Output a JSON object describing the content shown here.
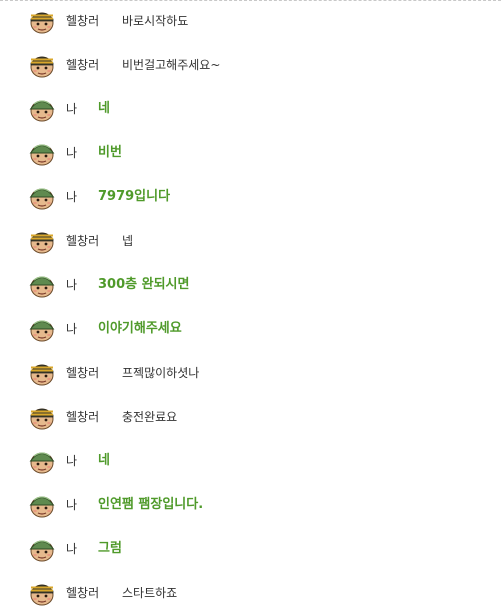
{
  "colors": {
    "my_text": "#4f9a2a",
    "other_text": "#333333"
  },
  "messages": [
    {
      "sender": "헬창러",
      "text": "바로시작하됴",
      "me": false,
      "avatar": "soldier-striped-cap-icon"
    },
    {
      "sender": "헬창러",
      "text": "비번걸고해주세요~",
      "me": false,
      "avatar": "soldier-striped-cap-icon"
    },
    {
      "sender": "나",
      "text": "네",
      "me": true,
      "avatar": "soldier-green-helmet-icon"
    },
    {
      "sender": "나",
      "text": "비번",
      "me": true,
      "avatar": "soldier-green-helmet-icon"
    },
    {
      "sender": "나",
      "text": "7979입니다",
      "me": true,
      "avatar": "soldier-green-helmet-icon"
    },
    {
      "sender": "헬창러",
      "text": "넵",
      "me": false,
      "avatar": "soldier-striped-cap-icon"
    },
    {
      "sender": "나",
      "text": "300층 완되시면",
      "me": true,
      "avatar": "soldier-green-helmet-icon"
    },
    {
      "sender": "나",
      "text": "이야기해주세요",
      "me": true,
      "avatar": "soldier-green-helmet-icon"
    },
    {
      "sender": "헬창러",
      "text": "프젝많이하셧나",
      "me": false,
      "avatar": "soldier-striped-cap-icon"
    },
    {
      "sender": "헬창러",
      "text": "충전완료요",
      "me": false,
      "avatar": "soldier-striped-cap-icon"
    },
    {
      "sender": "나",
      "text": "네",
      "me": true,
      "avatar": "soldier-green-helmet-icon"
    },
    {
      "sender": "나",
      "text": "인연팸 팸장입니다.",
      "me": true,
      "avatar": "soldier-green-helmet-icon"
    },
    {
      "sender": "나",
      "text": "그럼",
      "me": true,
      "avatar": "soldier-green-helmet-icon"
    },
    {
      "sender": "헬창러",
      "text": "스타트하죠",
      "me": false,
      "avatar": "soldier-striped-cap-icon"
    }
  ]
}
